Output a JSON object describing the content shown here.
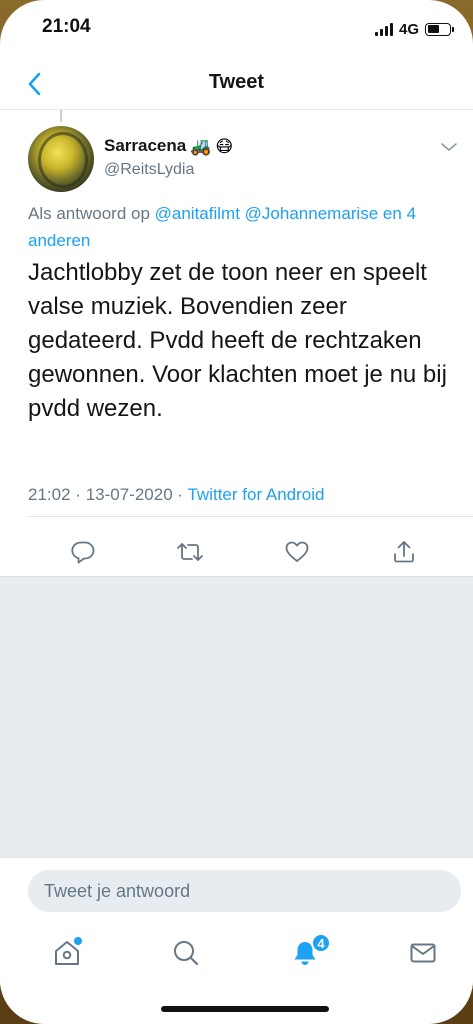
{
  "status": {
    "time": "21:04",
    "network": "4G"
  },
  "nav": {
    "title": "Tweet"
  },
  "tweet": {
    "display_name": "Sarracena",
    "emojis": [
      "🚜",
      "😷"
    ],
    "handle": "@ReitsLydia",
    "reply_prefix": "Als antwoord op",
    "reply_mentions": [
      "@anitafilmt",
      "@Johannemarise"
    ],
    "reply_connector": "en",
    "reply_others": "4 anderen",
    "text": "Jachtlobby zet de toon neer en speelt valse muziek. Bovendien zeer gedateerd. Pvdd heeft de rechtzaken gewonnen. Voor klachten moet je nu bij pvdd wezen.",
    "time": "21:02",
    "date": "13-07-2020",
    "separator": "·",
    "source": "Twitter for Android"
  },
  "compose": {
    "placeholder": "Tweet je antwoord"
  },
  "tabs": {
    "notifications_badge": "4"
  },
  "colors": {
    "accent": "#1da1f2",
    "secondary_text": "#657786",
    "feed_bg": "#e6ecf0"
  },
  "icons": {
    "back": "chevron-left-icon",
    "caret": "chevron-down-icon",
    "reply": "reply-icon",
    "retweet": "retweet-icon",
    "like": "heart-icon",
    "share": "share-icon",
    "home": "home-icon",
    "search": "search-icon",
    "notifications": "bell-icon",
    "messages": "mail-icon"
  }
}
